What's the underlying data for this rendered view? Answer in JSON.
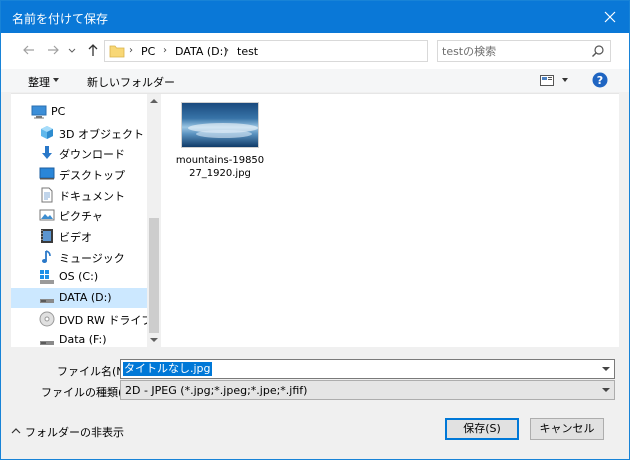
{
  "window": {
    "title": "名前を付けて保存"
  },
  "address": {
    "crumbs": [
      "PC",
      "DATA (D:)",
      "test"
    ],
    "search_placeholder": "testの検索"
  },
  "toolbar": {
    "organize": "整理",
    "new_folder": "新しいフォルダー"
  },
  "nav": {
    "items": [
      {
        "label": "PC",
        "icon": "computer-icon"
      },
      {
        "label": "3D オブジェクト",
        "icon": "cube-icon"
      },
      {
        "label": "ダウンロード",
        "icon": "download-icon"
      },
      {
        "label": "デスクトップ",
        "icon": "desktop-icon"
      },
      {
        "label": "ドキュメント",
        "icon": "document-icon"
      },
      {
        "label": "ピクチャ",
        "icon": "picture-icon"
      },
      {
        "label": "ビデオ",
        "icon": "video-icon"
      },
      {
        "label": "ミュージック",
        "icon": "music-icon"
      },
      {
        "label": "OS (C:)",
        "icon": "windows-drive-icon"
      },
      {
        "label": "DATA (D:)",
        "icon": "drive-icon"
      },
      {
        "label": "DVD RW ドライブ (E:)",
        "icon": "disc-icon"
      },
      {
        "label": "Data (F:)",
        "icon": "drive-icon"
      }
    ],
    "selected": "DATA (D:)"
  },
  "files": [
    {
      "name": "mountains-1985027_1920.jpg",
      "line1": "mountains-19850",
      "line2": "27_1920.jpg"
    }
  ],
  "form": {
    "filename_label": "ファイル名(N):",
    "filename_value": "タイトルなし.jpg",
    "type_label": "ファイルの種類(T):",
    "type_value": "2D - JPEG (*.jpg;*.jpeg;*.jpe;*.jfif)"
  },
  "footer": {
    "hide_folders": "フォルダーの非表示",
    "save": "保存(S)",
    "cancel": "キャンセル"
  },
  "colors": {
    "titlebar": "#0a78d7",
    "selection": "#cce8ff",
    "accent": "#0078d7"
  }
}
